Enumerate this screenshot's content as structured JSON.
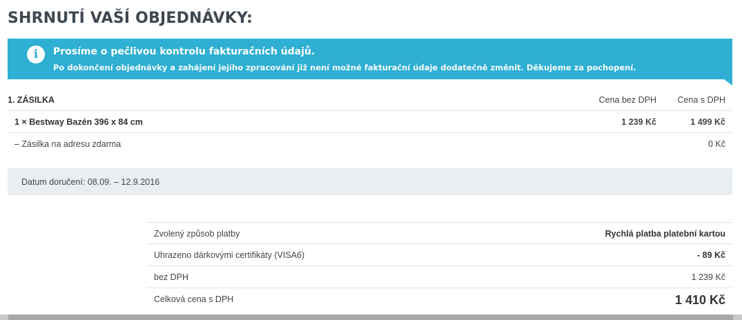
{
  "page_title": "SHRNUTÍ VAŠÍ OBJEDNÁVKY:",
  "info": {
    "icon": "info-icon",
    "icon_glyph": "i",
    "title": "Prosíme o pečlivou kontrolu fakturačních údajů.",
    "text": "Po dokončení objednávky a zahájení jejího zpracování již není možné fakturační údaje dodatečně změnit. Děkujeme za pochopení."
  },
  "shipment": {
    "label": "1. ZÁSILKA",
    "col_price_without_vat": "Cena bez DPH",
    "col_price_with_vat": "Cena s DPH",
    "items": [
      {
        "name": "1 × Bestway Bazén 396 x 84 cm",
        "price_without_vat": "1 239 Kč",
        "price_with_vat": "1 499 Kč"
      }
    ],
    "delivery_note": "– Zásilka na adresu zdarma",
    "delivery_price": "0 Kč",
    "delivery_date": "Datum doručení: 08.09. – 12.9.2016"
  },
  "summary": {
    "payment_label": "Zvolený způsob platby",
    "payment_value": "Rychlá platba platební kartou",
    "voucher_label": "Uhrazeno dárkovými certifikáty (VISA6)",
    "voucher_value": "- 89 Kč",
    "without_vat_label": "bez DPH",
    "without_vat_value": "1 239 Kč",
    "total_label": "Celková cena s DPH",
    "total_value": "1 410 Kč"
  },
  "colors": {
    "accent": "#2eafd3",
    "title": "#3f4750",
    "delivery_bg": "#e9eef2"
  }
}
